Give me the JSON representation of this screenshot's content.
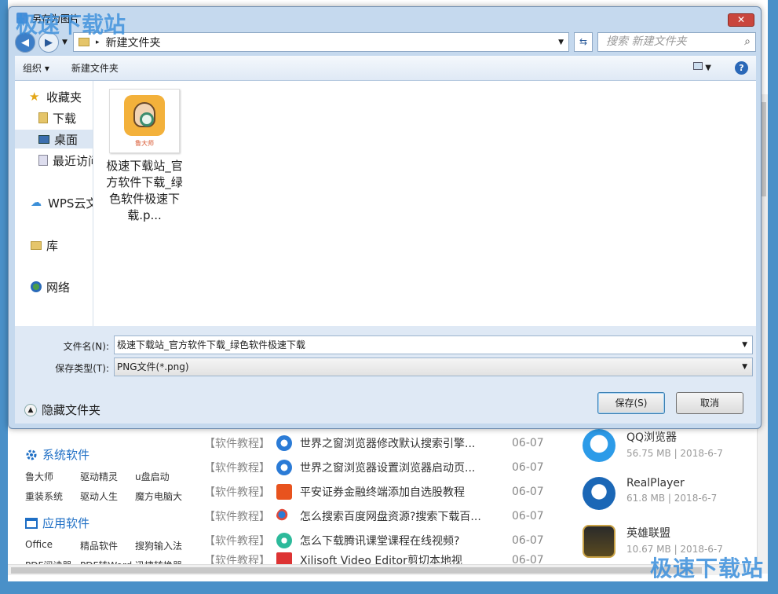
{
  "watermark": "极速下载站",
  "dialog": {
    "title": "另存为图片",
    "close_label": "✕",
    "address": {
      "path": "新建文件夹",
      "separator": "▸"
    },
    "search_placeholder": "搜索 新建文件夹",
    "toolbar": {
      "organize": "组织 ▾",
      "new_folder": "新建文件夹"
    },
    "nav": {
      "favorites": "收藏夹",
      "downloads": "下载",
      "desktop": "桌面",
      "recent": "最近访问的位置",
      "wps": "WPS云文档",
      "library": "库",
      "network": "网络"
    },
    "file": {
      "name": "极速下载站_官方软件下载_绿色软件极速下载.p...",
      "brand": "鲁大师"
    },
    "filename_label": "文件名(N):",
    "filename_value": "极速下载站_官方软件下载_绿色软件极速下载",
    "filetype_label": "保存类型(T):",
    "filetype_value": "PNG文件(*.png)",
    "hide_folders": "隐藏文件夹",
    "save_label": "保存(S)",
    "cancel_label": "取消"
  },
  "page": {
    "sys_title": "系统软件",
    "sys_links": [
      "鲁大师",
      "驱动精灵",
      "u盘启动",
      "重装系统",
      "驱动人生",
      "魔方电脑大"
    ],
    "app_title": "应用软件",
    "app_links": [
      "Office",
      "精品软件",
      "搜狗输入法",
      "PDF阅读器",
      "PDF转Word",
      "迅捷转换器"
    ],
    "articles": [
      {
        "tag": "【软件教程】",
        "title": "世界之窗浏览器修改默认搜索引擎...",
        "date": "06-07"
      },
      {
        "tag": "【软件教程】",
        "title": "世界之窗浏览器设置浏览器启动页...",
        "date": "06-07"
      },
      {
        "tag": "【软件教程】",
        "title": "平安证券金融终端添加自选股教程",
        "date": "06-07"
      },
      {
        "tag": "【软件教程】",
        "title": "怎么搜索百度网盘资源?搜索下载百...",
        "date": "06-07"
      },
      {
        "tag": "【软件教程】",
        "title": "怎么下载腾讯课堂课程在线视频?",
        "date": "06-07"
      },
      {
        "tag": "【软件教程】",
        "title": "Xilisoft Video Editor剪切本地视",
        "date": "06-07"
      }
    ],
    "software": [
      {
        "name": "QQ浏览器",
        "meta": "56.75 MB | 2018-6-7"
      },
      {
        "name": "RealPlayer",
        "meta": "61.8 MB | 2018-6-7"
      },
      {
        "name": "英雄联盟",
        "meta": "10.67 MB | 2018-6-7"
      }
    ]
  },
  "colors": {
    "accent": "#1f6fc5",
    "dialog_frame": "#c5d9ee",
    "close": "#c9463d"
  }
}
